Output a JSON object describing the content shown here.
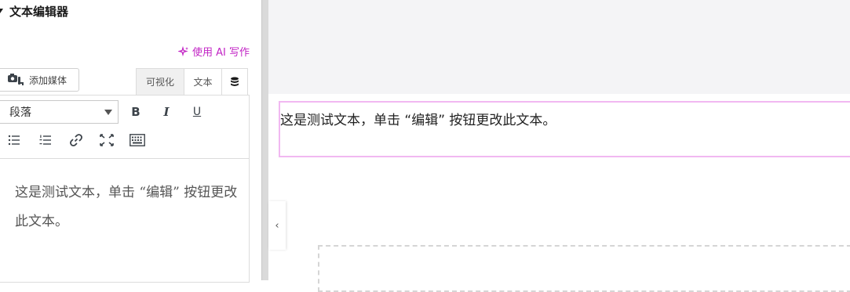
{
  "panel": {
    "title": "文本编辑器",
    "ai_link": "使用 AI 写作",
    "add_media": "添加媒体",
    "tabs": {
      "visual": "可视化",
      "text": "文本"
    },
    "format_select": "段落",
    "toolbar": {
      "bold": "B",
      "italic": "I",
      "underline": "U"
    },
    "content": "这是测试文本，单击 “编辑” 按钮更改此文本。"
  },
  "preview": {
    "text": "这是测试文本，单击 “编辑” 按钮更改此文本。",
    "collapse_label": "‹"
  },
  "colors": {
    "accent": "#c224c5",
    "selection_border": "#f1b8f1"
  }
}
